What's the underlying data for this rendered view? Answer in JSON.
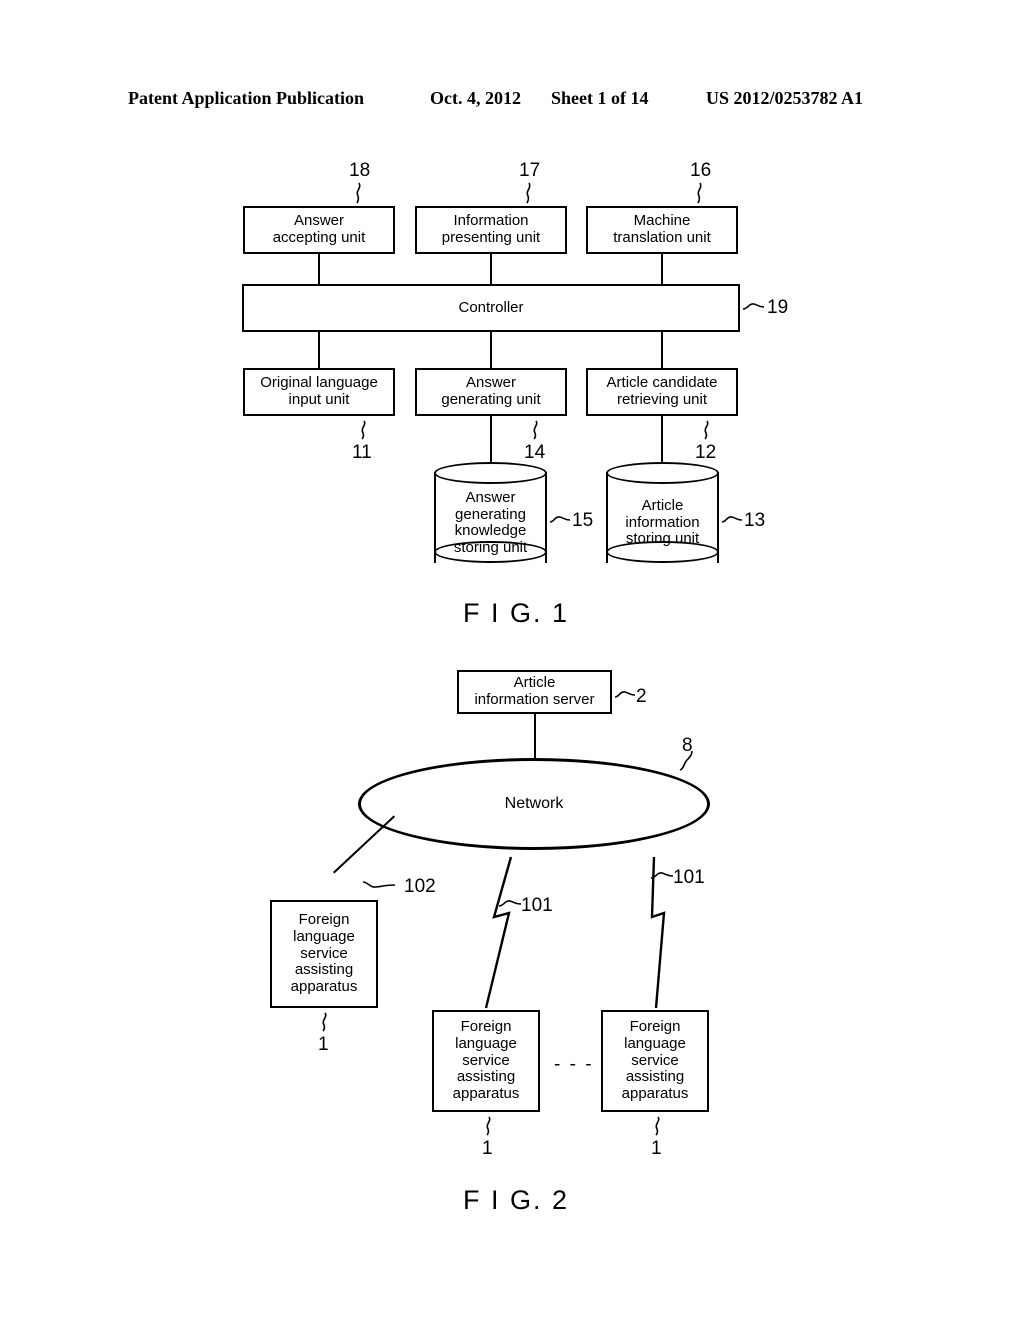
{
  "header": {
    "publication": "Patent Application Publication",
    "date": "Oct. 4, 2012",
    "sheet": "Sheet 1 of 14",
    "patent_number": "US 2012/0253782 A1"
  },
  "figure1": {
    "caption": "F I G. 1",
    "blocks": [
      {
        "id": "answer-accepting-unit",
        "line1": "Answer",
        "line2": "accepting unit",
        "ref": "18"
      },
      {
        "id": "information-presenting-unit",
        "line1": "Information",
        "line2": "presenting unit",
        "ref": "17"
      },
      {
        "id": "machine-translation-unit",
        "line1": "Machine",
        "line2": "translation unit",
        "ref": "16"
      },
      {
        "id": "controller",
        "line1": "Controller",
        "line2": "",
        "ref": "19"
      },
      {
        "id": "original-language-input-unit",
        "line1": "Original language",
        "line2": "input unit",
        "ref": "11"
      },
      {
        "id": "answer-generating-unit",
        "line1": "Answer",
        "line2": "generating unit",
        "ref": "14"
      },
      {
        "id": "article-candidate-retrieving-unit",
        "line1": "Article candidate",
        "line2": "retrieving unit",
        "ref": "12"
      }
    ],
    "stores": [
      {
        "id": "answer-generating-knowledge-storing-unit",
        "lines": [
          "Answer",
          "generating",
          "knowledge",
          "storing unit"
        ],
        "ref": "15"
      },
      {
        "id": "article-information-storing-unit",
        "lines": [
          "Article",
          "information",
          "storing unit"
        ],
        "ref": "13"
      }
    ]
  },
  "figure2": {
    "caption": "F I G. 2",
    "server": {
      "line1": "Article",
      "line2": "information server",
      "ref": "2"
    },
    "network": {
      "label": "Network",
      "ref": "8"
    },
    "apparatus_lines": [
      "Foreign",
      "language",
      "service",
      "assisting",
      "apparatus"
    ],
    "apparatuses": [
      {
        "id": "apparatus-left",
        "ref": "1",
        "link_ref": "102",
        "link_type": "wired"
      },
      {
        "id": "apparatus-middle",
        "ref": "1",
        "link_ref": "101",
        "link_type": "wireless"
      },
      {
        "id": "apparatus-right",
        "ref": "1",
        "link_ref": "101",
        "link_type": "wireless"
      }
    ],
    "ellipsis": "- - - -"
  }
}
